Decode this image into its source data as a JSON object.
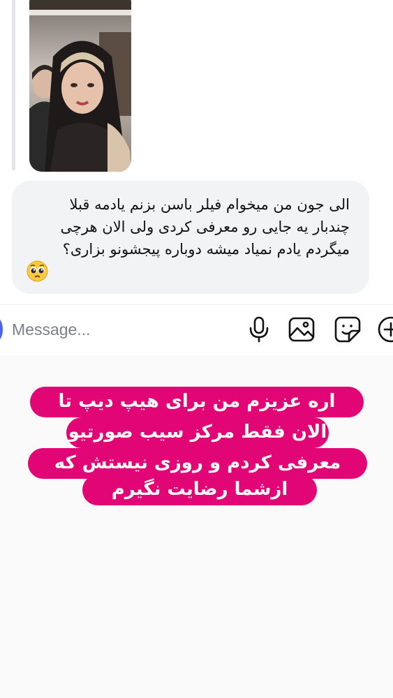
{
  "conversation": {
    "received_message": {
      "lines": [
        "الی جون من میخوام فیلر باسن بزنم یادمه قبلا",
        "چندبار یه جایی رو معرفی کردی ولی الان هرچی",
        "میگردم یادم نمیاد میشه دوباره پیجشونو بزاری؟"
      ],
      "emoji": "pleading-face-emoji"
    },
    "story_reply": {
      "icon": "story-photo-thumbnail"
    }
  },
  "composer": {
    "placeholder": "Message...",
    "icons": [
      "microphone-icon",
      "gallery-icon",
      "sticker-icon",
      "add-icon"
    ]
  },
  "story_text": {
    "lines": [
      "اره عزیزم من برای هیپ دیپ تا",
      "الان فقط مرکز سیب صورتیو",
      "معرفی کردم و روزی نیستش که",
      "ازشما رضایت نگیرم"
    ],
    "highlight_color": "#e10575",
    "text_color": "#ffffff"
  },
  "colors": {
    "bubble_bg": "#f2f3f5",
    "accent": "#4a63f0"
  }
}
